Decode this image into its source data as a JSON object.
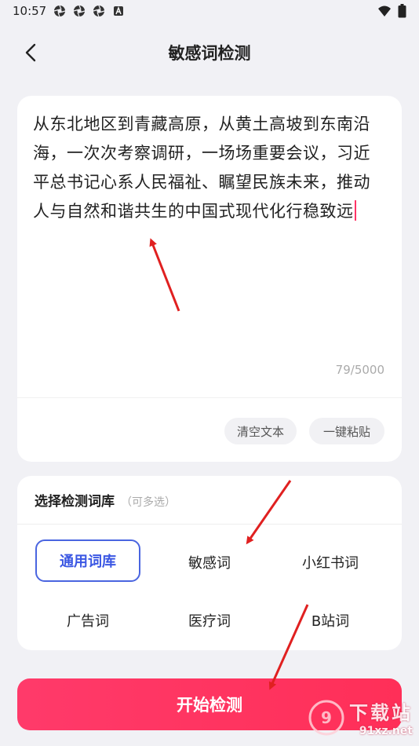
{
  "status_bar": {
    "time": "10:57",
    "notif_icons": [
      "aperture-icon",
      "aperture-icon",
      "aperture-icon",
      "font-a-icon"
    ],
    "right_icons": [
      "wifi-icon",
      "battery-icon"
    ]
  },
  "header": {
    "title": "敏感词检测",
    "back_icon": "chevron-left-icon"
  },
  "editor": {
    "text": "从东北地区到青藏高原，从黄土高坡到东南沿海，一次次考察调研，一场场重要会议，习近平总书记心系人民福祉、瞩望民族未来，推动人与自然和谐共生的中国式现代化行稳致远",
    "char_count": "79/5000",
    "clear_label": "清空文本",
    "paste_label": "一键粘贴"
  },
  "library": {
    "title": "选择检测词库",
    "hint": "（可多选）",
    "options": [
      {
        "label": "通用词库",
        "selected": true
      },
      {
        "label": "敏感词",
        "selected": false
      },
      {
        "label": "小红书词",
        "selected": false
      },
      {
        "label": "广告词",
        "selected": false
      },
      {
        "label": "医疗词",
        "selected": false
      },
      {
        "label": "B站词",
        "selected": false
      }
    ]
  },
  "start_button": {
    "label": "开始检测"
  },
  "watermark": {
    "title": "下载站",
    "url": "91xz.net",
    "logo_icon": "91-logo-icon"
  },
  "colors": {
    "accent": "#ff3366",
    "selected_border": "#4a65e0",
    "annotation_arrow": "#e02020",
    "background": "#f1f1f5"
  }
}
